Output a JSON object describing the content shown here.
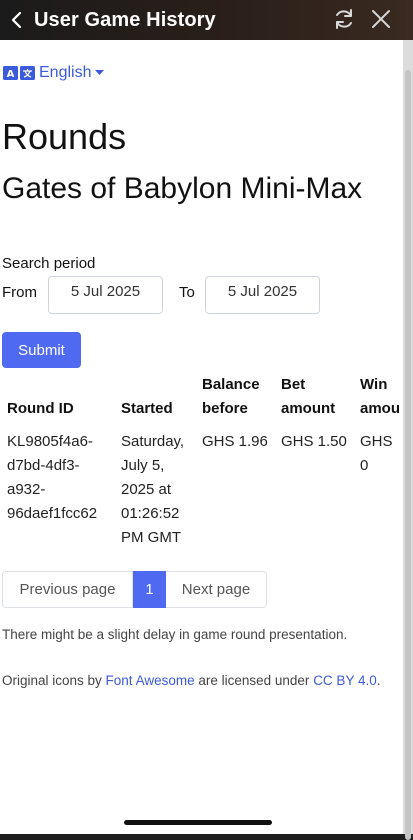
{
  "topbar": {
    "title": "User Game History"
  },
  "language": {
    "label": "English"
  },
  "page": {
    "heading": "Rounds",
    "game_name": "Gates of Babylon Mini-Max"
  },
  "search": {
    "period_label": "Search period",
    "from_label": "From",
    "from_value": "5 Jul 2025",
    "to_label": "To",
    "to_value": "5 Jul 2025",
    "submit_label": "Submit"
  },
  "table": {
    "headers": {
      "round_id": "Round ID",
      "started": "Started",
      "balance_before_1": "Balance",
      "balance_before_2": "before",
      "bet_amount_1": "Bet",
      "bet_amount_2": "amount",
      "win_amount_1": "Win",
      "win_amount_2": "amou"
    },
    "row": {
      "round_id_lines": [
        "KL9805f4a6-",
        "d7bd-4df3-",
        "a932-",
        "96daef1fcc62"
      ],
      "started_lines": [
        "Saturday,",
        "July 5,",
        "2025 at",
        "01:26:52",
        "PM GMT"
      ],
      "balance_before": "GHS 1.96",
      "bet_amount": "GHS 1.50",
      "win_amount": "GHS 0"
    }
  },
  "pagination": {
    "previous_label": "Previous page",
    "current_page": "1",
    "next_label": "Next page"
  },
  "footer": {
    "delay_note": "There might be a slight delay in game round presentation.",
    "credits_prefix": "Original icons by ",
    "credits_link": "Font Awesome",
    "credits_middle": " are licensed under ",
    "credits_license": "CC BY 4.0",
    "credits_suffix": "."
  },
  "colors": {
    "accent": "#4f6af0",
    "link": "#3b5bdb",
    "topbar": "#1b1b1b"
  },
  "icons": [
    "back-chevron-icon",
    "refresh-icon",
    "close-icon",
    "translate-icon",
    "caret-down-icon"
  ]
}
